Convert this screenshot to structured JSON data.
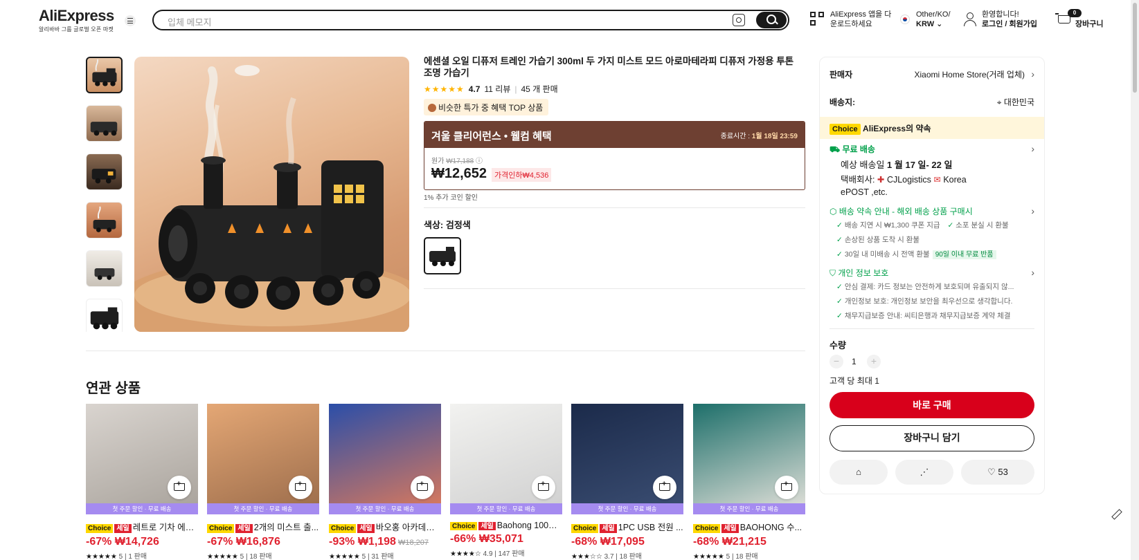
{
  "header": {
    "logo": "AliExpress",
    "logo_sub": "알리바바 그룹 글로벌 오픈 마켓",
    "search_placeholder": "입체 메모지",
    "app_line1": "AliExpress 앱을 다",
    "app_line2": "운로드하세요",
    "region_line1": "Other/KO/",
    "region_line2": "KRW",
    "user_line1": "환영합니다!",
    "user_line2": "로그인 / 회원가입",
    "cart_count": "0",
    "cart_label": "장바구니"
  },
  "product": {
    "title": "에센셜 오일 디퓨저 트레인 가습기 300ml 두 가지 미스트 모드 아로마테라피 디퓨저 가정용 투톤 조명 가습기",
    "stars": "★★★★★",
    "rating": "4.7",
    "reviews": "11 리뷰",
    "sold": "45 개 판매",
    "top_badge": "비슷한 특가 중 혜택 TOP 상품",
    "promo_title": "겨울 클리어런스 • 웰컴 혜택",
    "promo_end_label": "종료시간 :",
    "promo_end_time": "1월 18일 23:59",
    "orig_label": "원가",
    "orig_price": "₩17,188",
    "price": "₩12,652",
    "discount": "가격인하₩4,536",
    "coin_note": "1% 추가 코인 할인",
    "color_label": "색상: 검정색"
  },
  "panel": {
    "seller_label": "판매자",
    "seller_name": "Xiaomi Home Store(거래 업체)",
    "ship_to_label": "배송지:",
    "ship_to": "대한민국",
    "choice_tag": "Choice",
    "choice_text": "AliExpress의 약속",
    "free_ship": "무료 배송",
    "est_label": "예상 배송일",
    "est_date": "1 월 17 일- 22 일",
    "carrier_label": "택배회사:",
    "carrier1": "CJLogistics",
    "carrier2": "Korea",
    "carrier3": "ePOST ,etc.",
    "promise_title": "배송 약속 안내 - 해외 배송 상품 구매시",
    "promise1": "배송 지연 시 ₩1,300 쿠폰 지급",
    "promise1b": "소포 분실 시 환불",
    "promise2": "손상된 상품 도착 시 환불",
    "promise3": "30일 내 미배송 시 전액 환불",
    "promise3_tag": "90일 이내 무료 반품",
    "privacy_title": "개인 정보 보호",
    "privacy1": "안심 결제: 카드 정보는 안전하게 보호되며 유출되지 않...",
    "privacy2": "개인정보 보호: 개인정보 보안을 최우선으로 생각합니다.",
    "privacy3": "채무지급보증 안내: 씨티은행과 채무지급보증 계약 체결",
    "qty_label": "수량",
    "qty_minus": "−",
    "qty_value": "1",
    "qty_plus": "+",
    "limit": "고객 당 최대 1",
    "buy_now": "바로 구매",
    "add_cart": "장바구니 담기",
    "wish_count": "53"
  },
  "related": {
    "title": "연관 상품",
    "band": "첫 주문 할인 · 무료 배송",
    "items": [
      {
        "choice": "Choice",
        "sale": "세일",
        "title": "레트로 기차 에센...",
        "disc": "-67%",
        "price": "₩14,726",
        "was": "",
        "stars": "★★★★★",
        "rate": "5",
        "sold": "1 판매",
        "c1": "#d9d4cf",
        "c2": "#a7a19a"
      },
      {
        "choice": "Choice",
        "sale": "세일",
        "title": "2개의 미스트 출...",
        "disc": "-67%",
        "price": "₩16,876",
        "was": "",
        "stars": "★★★★★",
        "rate": "5",
        "sold": "18 판매",
        "c1": "#e4a775",
        "c2": "#9a6b4a"
      },
      {
        "choice": "Choice",
        "sale": "세일",
        "title": "바오홍 아카데미 ...",
        "disc": "-93%",
        "price": "₩1,198",
        "was": "₩18,207",
        "stars": "★★★★★",
        "rate": "5",
        "sold": "31 판매",
        "c1": "#2b4ea8",
        "c2": "#e07b5a"
      },
      {
        "choice": "Choice",
        "sale": "세일",
        "title": "Baohong 100%...",
        "disc": "-66%",
        "price": "₩35,071",
        "was": "",
        "stars": "★★★★☆",
        "rate": "4.9",
        "sold": "147 판매",
        "c1": "#f2f2f0",
        "c2": "#cfcfcf"
      },
      {
        "choice": "Choice",
        "sale": "세일",
        "title": "1PC USB 전원 ...",
        "disc": "-68%",
        "price": "₩17,095",
        "was": "",
        "stars": "★★★☆☆",
        "rate": "3.7",
        "sold": "18 판매",
        "c1": "#1b2a4a",
        "c2": "#3c4f74"
      },
      {
        "choice": "Choice",
        "sale": "세일",
        "title": "BAOHONG 수...",
        "disc": "-68%",
        "price": "₩21,215",
        "was": "",
        "stars": "★★★★★",
        "rate": "5",
        "sold": "18 판매",
        "c1": "#1d6f6a",
        "c2": "#e8e4dd"
      }
    ]
  },
  "colors": {
    "accent": "#d8001b",
    "choice": "#ffd800",
    "green": "#00a04a",
    "promo": "#6e4032"
  }
}
